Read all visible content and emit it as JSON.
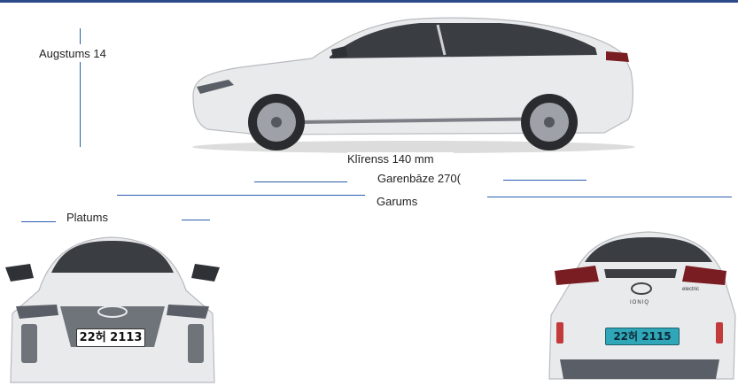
{
  "dimensions": {
    "height_label": "Augstums 14",
    "ground_clearance_label": "Klīrenss 140 mm",
    "wheelbase_label": "Garenbāze 270(",
    "length_label": "Garums",
    "width_label": "Platums"
  },
  "plates": {
    "front": "22허 2113",
    "rear": "22허 2115"
  },
  "badges": {
    "rear_model": "IONIQ",
    "rear_variant": "electric"
  },
  "colors": {
    "accent_line": "#2a5db0",
    "top_bar": "#2d4a8a",
    "car_body": "#e9eaec",
    "rear_plate_bg": "#2fa7b8"
  }
}
